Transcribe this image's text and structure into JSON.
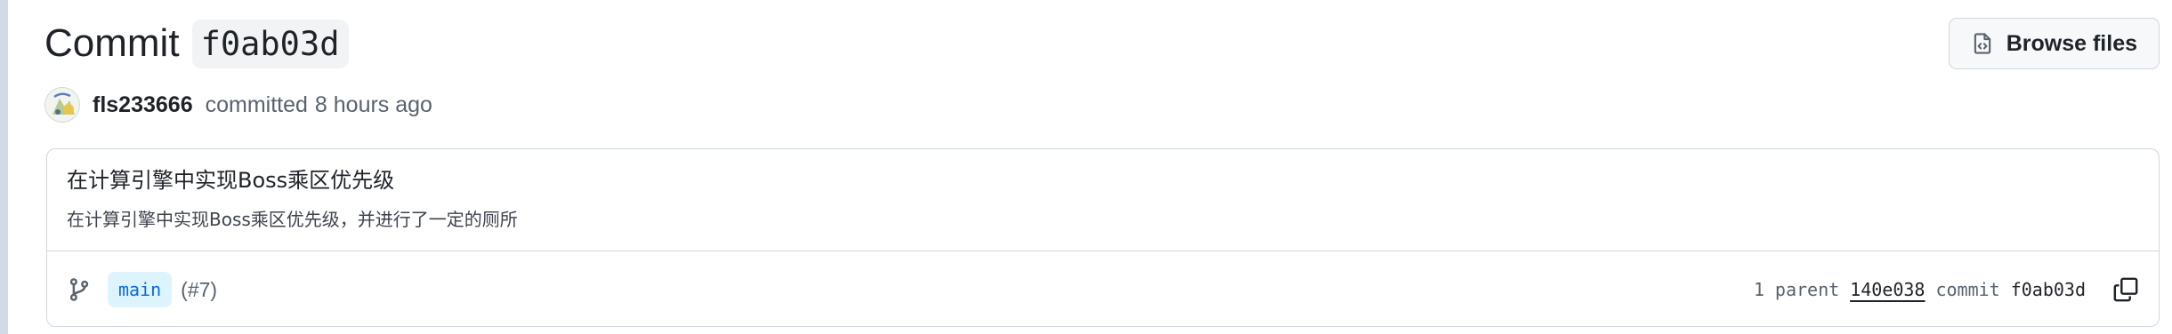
{
  "header": {
    "title_word": "Commit",
    "sha": "f0ab03d",
    "browse_label": "Browse files",
    "browse_icon": "file-code-icon"
  },
  "author": {
    "name": "fls233666",
    "action": "committed",
    "time": "8 hours ago",
    "avatar_icon": "user-avatar"
  },
  "message": {
    "title": "在计算引擎中实现Boss乘区优先级",
    "body": "在计算引擎中实现Boss乘区优先级，并进行了一定的厕所"
  },
  "footer": {
    "branch_icon": "git-branch-icon",
    "branch": "main",
    "pr_ref": "(#7)",
    "parent_count_label": "1 parent",
    "parent_sha": "140e038",
    "commit_label": "commit",
    "commit_sha": "f0ab03d",
    "copy_icon": "copy-icon"
  },
  "colors": {
    "accent": "#0969da",
    "branch_bg": "#ddf4ff",
    "border": "#d0d7de",
    "muted_text": "#59636e"
  }
}
